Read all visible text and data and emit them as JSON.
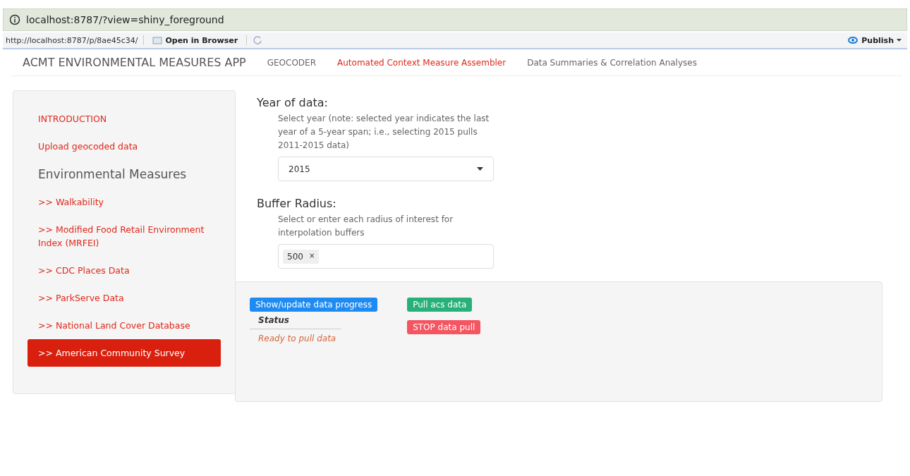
{
  "address_bar": {
    "url": "localhost:8787/?view=shiny_foreground"
  },
  "toolbar": {
    "url": "http://localhost:8787/p/8ae45c34/",
    "open_button": "Open in Browser",
    "publish_button": "Publish"
  },
  "navbar": {
    "brand": "ACMT ENVIRONMENTAL MEASURES APP",
    "tabs": [
      {
        "label": "GEOCODER",
        "selected": false
      },
      {
        "label": "Automated Context Measure Assembler",
        "selected": true
      },
      {
        "label": "Data Summaries & Correlation Analyses",
        "selected": false
      }
    ]
  },
  "sidebar": {
    "items": [
      {
        "kind": "link",
        "label": "INTRODUCTION",
        "selected": false
      },
      {
        "kind": "link",
        "label": "Upload geocoded data",
        "selected": false
      },
      {
        "kind": "heading",
        "label": "Environmental Measures"
      },
      {
        "kind": "link",
        "label": ">> Walkability",
        "selected": false
      },
      {
        "kind": "link",
        "label": ">> Modified Food Retail Environment Index (MRFEI)",
        "selected": false
      },
      {
        "kind": "link",
        "label": ">> CDC Places Data",
        "selected": false
      },
      {
        "kind": "link",
        "label": ">> ParkServe Data",
        "selected": false
      },
      {
        "kind": "link",
        "label": ">> National Land Cover Database",
        "selected": false
      },
      {
        "kind": "link",
        "label": ">> American Community Survey",
        "selected": true
      }
    ]
  },
  "year": {
    "title": "Year of data:",
    "help": "Select year (note: selected year indicates the last year of a 5-year span; i.e., selecting 2015 pulls 2011-2015 data)",
    "value": "2015"
  },
  "buffer": {
    "title": "Buffer Radius:",
    "help": "Select or enter each radius of interest for interpolation buffers",
    "tags": [
      {
        "label": "500",
        "remove": "×"
      }
    ]
  },
  "actions": {
    "progress_button": "Show/update data progress",
    "status_heading": "Status",
    "status_text": "Ready to pull data",
    "pull_button": "Pull acs data",
    "stop_button": "STOP data pull"
  }
}
